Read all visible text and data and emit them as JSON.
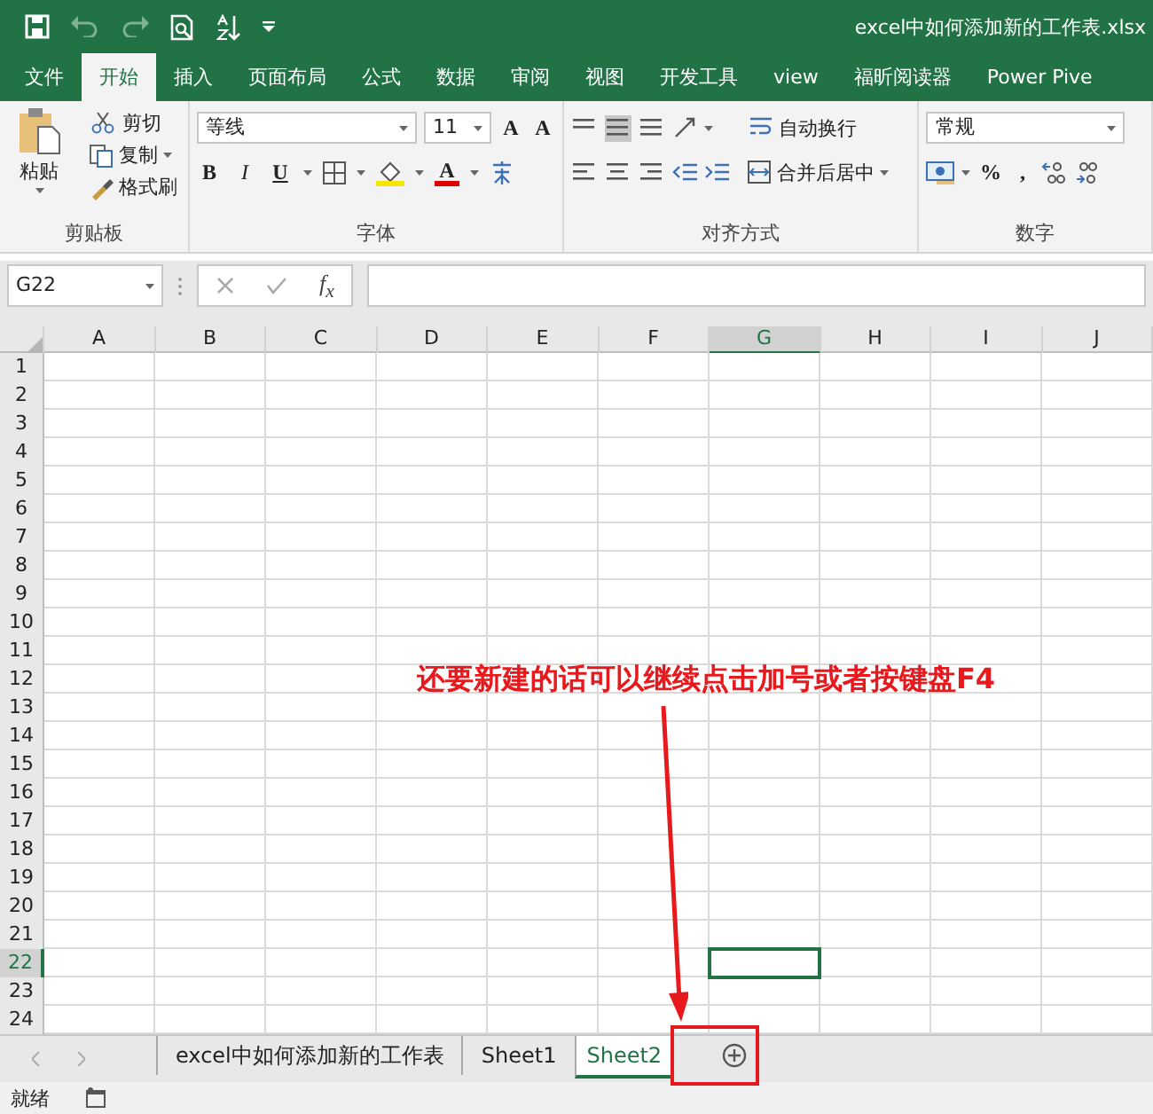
{
  "title_bar": {
    "title": "excel中如何添加新的工作表.xlsx"
  },
  "ribbon_tabs": [
    {
      "label": "文件",
      "selected": false
    },
    {
      "label": "开始",
      "selected": true
    },
    {
      "label": "插入",
      "selected": false
    },
    {
      "label": "页面布局",
      "selected": false
    },
    {
      "label": "公式",
      "selected": false
    },
    {
      "label": "数据",
      "selected": false
    },
    {
      "label": "审阅",
      "selected": false
    },
    {
      "label": "视图",
      "selected": false
    },
    {
      "label": "开发工具",
      "selected": false
    },
    {
      "label": "view",
      "selected": false
    },
    {
      "label": "福昕阅读器",
      "selected": false
    },
    {
      "label": "Power Pive",
      "selected": false
    }
  ],
  "clipboard": {
    "paste": "粘贴",
    "cut": "剪切",
    "copy": "复制",
    "format_painter": "格式刷",
    "label": "剪贴板"
  },
  "font": {
    "font_name": "等线",
    "font_size": "11",
    "grow": "A",
    "shrink": "A",
    "bold": "B",
    "italic": "I",
    "underline": "U",
    "font_color": "A",
    "label": "字体"
  },
  "alignment": {
    "wrap_text": "自动换行",
    "merge_center": "合并后居中",
    "label": "对齐方式"
  },
  "number": {
    "format": "常规",
    "percent": "%",
    "comma": ",",
    "label": "数字"
  },
  "formula_bar": {
    "name_box": "G22",
    "fx": "f$_{x}$"
  },
  "columns": [
    {
      "label": "A",
      "selected": false
    },
    {
      "label": "B",
      "selected": false
    },
    {
      "label": "C",
      "selected": false
    },
    {
      "label": "D",
      "selected": false
    },
    {
      "label": "E",
      "selected": false
    },
    {
      "label": "F",
      "selected": false
    },
    {
      "label": "G",
      "selected": true
    },
    {
      "label": "H",
      "selected": false
    },
    {
      "label": "I",
      "selected": false
    },
    {
      "label": "J",
      "selected": false
    }
  ],
  "rows": [
    {
      "label": "1",
      "selected": false
    },
    {
      "label": "2",
      "selected": false
    },
    {
      "label": "3",
      "selected": false
    },
    {
      "label": "4",
      "selected": false
    },
    {
      "label": "5",
      "selected": false
    },
    {
      "label": "6",
      "selected": false
    },
    {
      "label": "7",
      "selected": false
    },
    {
      "label": "8",
      "selected": false
    },
    {
      "label": "9",
      "selected": false
    },
    {
      "label": "10",
      "selected": false
    },
    {
      "label": "11",
      "selected": false
    },
    {
      "label": "12",
      "selected": false
    },
    {
      "label": "13",
      "selected": false
    },
    {
      "label": "14",
      "selected": false
    },
    {
      "label": "15",
      "selected": false
    },
    {
      "label": "16",
      "selected": false
    },
    {
      "label": "17",
      "selected": false
    },
    {
      "label": "18",
      "selected": false
    },
    {
      "label": "19",
      "selected": false
    },
    {
      "label": "20",
      "selected": false
    },
    {
      "label": "21",
      "selected": false
    },
    {
      "label": "22",
      "selected": true
    },
    {
      "label": "23",
      "selected": false
    },
    {
      "label": "24",
      "selected": false
    }
  ],
  "sheet_tabs": [
    {
      "label": "excel中如何添加新的工作表",
      "selected": false
    },
    {
      "label": "Sheet1",
      "selected": false
    },
    {
      "label": "Sheet2",
      "selected": true
    }
  ],
  "status_bar": {
    "status": "就绪"
  },
  "annotation": {
    "text": "还要新建的话可以继续点击加号或者按键盘F4"
  }
}
